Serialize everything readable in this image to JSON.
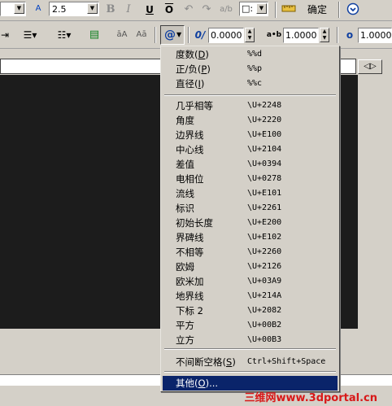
{
  "toolbar1": {
    "font_size_value": "2.5",
    "bold": "B",
    "italic": "I",
    "underline": "U",
    "overline": "O",
    "color_value": "□:",
    "ok_label": "确定"
  },
  "toolbar2": {
    "symbol_button": "@",
    "oblique_value": "0.0000",
    "tracking_label": "a•b",
    "tracking_value": "1.0000",
    "width_value": "1.0000",
    "stack_label": "āA",
    "case_label": "Aā"
  },
  "symbol_menu": {
    "items_top": [
      {
        "label": "度数",
        "hotkey": "D",
        "code": "%%d"
      },
      {
        "label": "正/负",
        "hotkey": "P",
        "code": "%%p"
      },
      {
        "label": "直径",
        "hotkey": "I",
        "code": "%%c"
      }
    ],
    "items_mid": [
      {
        "label": "几乎相等",
        "code": "\\U+2248"
      },
      {
        "label": "角度",
        "code": "\\U+2220"
      },
      {
        "label": "边界线",
        "code": "\\U+E100"
      },
      {
        "label": "中心线",
        "code": "\\U+2104"
      },
      {
        "label": "差值",
        "code": "\\U+0394"
      },
      {
        "label": "电相位",
        "code": "\\U+0278"
      },
      {
        "label": "流线",
        "code": "\\U+E101"
      },
      {
        "label": "标识",
        "code": "\\U+2261"
      },
      {
        "label": "初始长度",
        "code": "\\U+E200"
      },
      {
        "label": "界碑线",
        "code": "\\U+E102"
      },
      {
        "label": "不相等",
        "code": "\\U+2260"
      },
      {
        "label": "欧姆",
        "code": "\\U+2126"
      },
      {
        "label": "欧米加",
        "code": "\\U+03A9"
      },
      {
        "label": "地界线",
        "code": "\\U+214A"
      },
      {
        "label": "下标 2",
        "code": "\\U+2082"
      },
      {
        "label": "平方",
        "code": "\\U+00B2"
      },
      {
        "label": "立方",
        "code": "\\U+00B3"
      }
    ],
    "nbsp": {
      "label": "不间断空格",
      "hotkey": "S",
      "code": "Ctrl+Shift+Space"
    },
    "other": {
      "label": "其他",
      "hotkey": "O",
      "suffix": "..."
    }
  },
  "watermark": "三维网www.3dportal.cn",
  "colors": {
    "selection": "#0a246a",
    "editor_bg": "#1c1c1c",
    "face": "#d4d0c8"
  }
}
